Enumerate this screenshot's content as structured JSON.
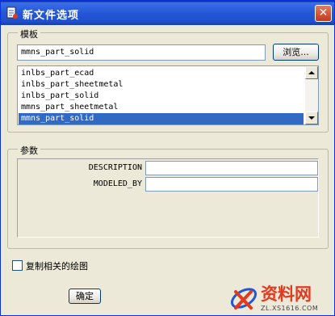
{
  "window": {
    "title": "新文件选项",
    "close_glyph": "✕"
  },
  "template_group": {
    "label": "模板",
    "selected_template": "mmns_part_solid",
    "browse_label": "浏览...",
    "items": [
      {
        "label": "inlbs_part_ecad",
        "selected": false
      },
      {
        "label": "inlbs_part_sheetmetal",
        "selected": false
      },
      {
        "label": "inlbs_part_solid",
        "selected": false
      },
      {
        "label": "mmns_part_sheetmetal",
        "selected": false
      },
      {
        "label": "mmns_part_solid",
        "selected": true
      }
    ]
  },
  "params_group": {
    "label": "参数",
    "rows": [
      {
        "name": "DESCRIPTION",
        "value": ""
      },
      {
        "name": "MODELED_BY",
        "value": ""
      }
    ]
  },
  "copy_drawing": {
    "label": "复制相关的绘图",
    "checked": false
  },
  "ok_label": "确定",
  "watermark": {
    "main": "资料网",
    "sub": "ZL.XS1616.COM"
  },
  "colors": {
    "titlebar": "#2457d6",
    "selection": "#316ac5",
    "dialog_bg": "#ece9d8",
    "watermark_red": "#e23a1f"
  },
  "icons": [
    "app-icon",
    "close-icon",
    "scroll-up-icon",
    "scroll-down-icon",
    "watermark-logo-icon"
  ]
}
